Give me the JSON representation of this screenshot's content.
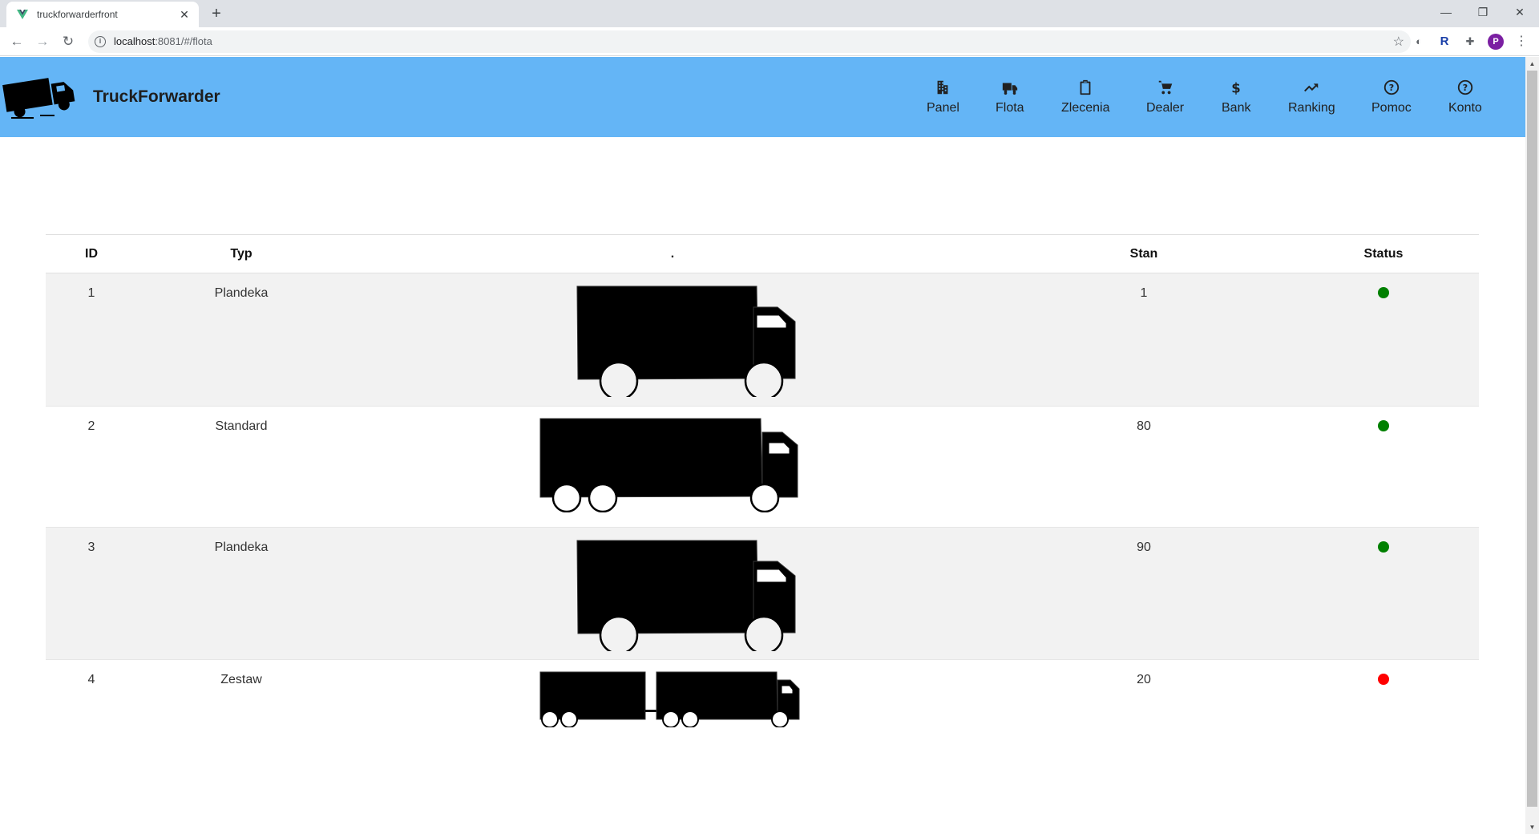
{
  "browser": {
    "tab_title": "truckforwarderfront",
    "url_host": "localhost",
    "url_path": ":8081/#/flota",
    "avatar_letter": "P"
  },
  "app": {
    "brand": "TruckForwarder",
    "nav": [
      {
        "label": "Panel",
        "icon": "office-building-icon"
      },
      {
        "label": "Flota",
        "icon": "truck-icon"
      },
      {
        "label": "Zlecenia",
        "icon": "clipboard-icon"
      },
      {
        "label": "Dealer",
        "icon": "cart-icon"
      },
      {
        "label": "Bank",
        "icon": "dollar-icon"
      },
      {
        "label": "Ranking",
        "icon": "trending-up-icon"
      },
      {
        "label": "Pomoc",
        "icon": "help-circle-icon"
      },
      {
        "label": "Konto",
        "icon": "help-circle-icon"
      }
    ]
  },
  "table": {
    "headers": {
      "id": "ID",
      "type": "Typ",
      "image": ".",
      "stan": "Stan",
      "status": "Status"
    },
    "rows": [
      {
        "id": "1",
        "type": "Plandeka",
        "stan": "1",
        "status_color": "#008000",
        "image": "box-truck-icon"
      },
      {
        "id": "2",
        "type": "Standard",
        "stan": "80",
        "status_color": "#008000",
        "image": "three-axle-truck-icon"
      },
      {
        "id": "3",
        "type": "Plandeka",
        "stan": "90",
        "status_color": "#008000",
        "image": "box-truck-icon"
      },
      {
        "id": "4",
        "type": "Zestaw",
        "stan": "20",
        "status_color": "#ff0000",
        "image": "truck-trailer-icon"
      }
    ]
  },
  "colors": {
    "appbar": "#64b5f6",
    "status_ok": "#008000",
    "status_bad": "#ff0000"
  }
}
